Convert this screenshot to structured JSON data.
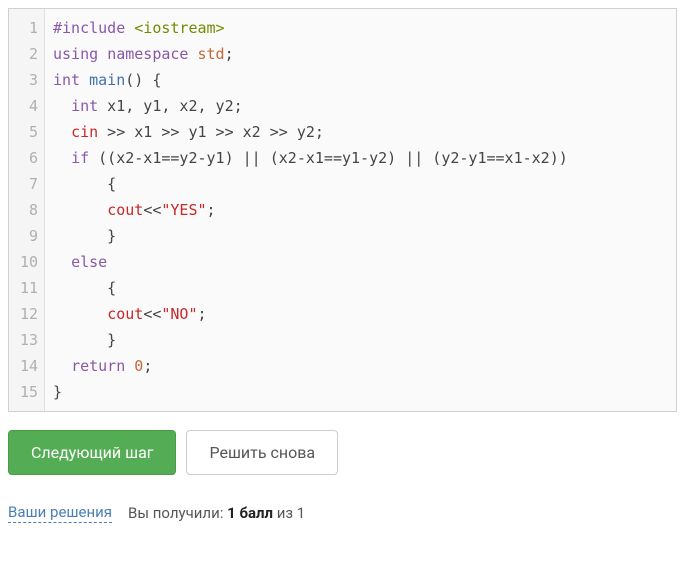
{
  "code": {
    "lines": [
      {
        "n": "1",
        "tokens": [
          [
            "preproc",
            "#include "
          ],
          [
            "inc",
            "<iostream>"
          ]
        ]
      },
      {
        "n": "2",
        "tokens": [
          [
            "kw",
            "using"
          ],
          [
            "plain",
            " "
          ],
          [
            "kw",
            "namespace"
          ],
          [
            "plain",
            " "
          ],
          [
            "classname",
            "std"
          ],
          [
            "op",
            ";"
          ]
        ]
      },
      {
        "n": "3",
        "tokens": [
          [
            "type",
            "int"
          ],
          [
            "plain",
            " "
          ],
          [
            "id",
            "main"
          ],
          [
            "op",
            "() {"
          ]
        ]
      },
      {
        "n": "4",
        "tokens": [
          [
            "plain",
            "  "
          ],
          [
            "type",
            "int"
          ],
          [
            "plain",
            " x1, y1, x2, y2;"
          ]
        ]
      },
      {
        "n": "5",
        "tokens": [
          [
            "plain",
            "  "
          ],
          [
            "var",
            "cin"
          ],
          [
            "plain",
            " >> x1 >> y1 >> x2 >> y2;"
          ]
        ]
      },
      {
        "n": "6",
        "tokens": [
          [
            "plain",
            "  "
          ],
          [
            "kw",
            "if"
          ],
          [
            "plain",
            " ((x2-x1==y2-y1) || (x2-x1==y1-y2) || (y2-y1==x1-x2))"
          ]
        ]
      },
      {
        "n": "7",
        "tokens": [
          [
            "plain",
            "      {"
          ]
        ]
      },
      {
        "n": "8",
        "tokens": [
          [
            "plain",
            "      "
          ],
          [
            "var",
            "cout"
          ],
          [
            "plain",
            "<<"
          ],
          [
            "str",
            "\"YES\""
          ],
          [
            "plain",
            ";"
          ]
        ]
      },
      {
        "n": "9",
        "tokens": [
          [
            "plain",
            "      }"
          ]
        ]
      },
      {
        "n": "10",
        "tokens": [
          [
            "plain",
            "  "
          ],
          [
            "kw",
            "else"
          ]
        ]
      },
      {
        "n": "11",
        "tokens": [
          [
            "plain",
            "      {"
          ]
        ]
      },
      {
        "n": "12",
        "tokens": [
          [
            "plain",
            "      "
          ],
          [
            "var",
            "cout"
          ],
          [
            "plain",
            "<<"
          ],
          [
            "str",
            "\"NO\""
          ],
          [
            "plain",
            ";"
          ]
        ]
      },
      {
        "n": "13",
        "tokens": [
          [
            "plain",
            "      }"
          ]
        ]
      },
      {
        "n": "14",
        "tokens": [
          [
            "plain",
            "  "
          ],
          [
            "kw",
            "return"
          ],
          [
            "plain",
            " "
          ],
          [
            "num",
            "0"
          ],
          [
            "plain",
            ";"
          ]
        ]
      },
      {
        "n": "15",
        "tokens": [
          [
            "plain",
            "}"
          ]
        ]
      }
    ]
  },
  "buttons": {
    "next_step": "Следующий шаг",
    "retry": "Решить снова"
  },
  "footer": {
    "solutions_link": "Ваши решения",
    "score_prefix": "Вы получили: ",
    "score_value": "1 балл",
    "score_suffix": " из 1"
  }
}
